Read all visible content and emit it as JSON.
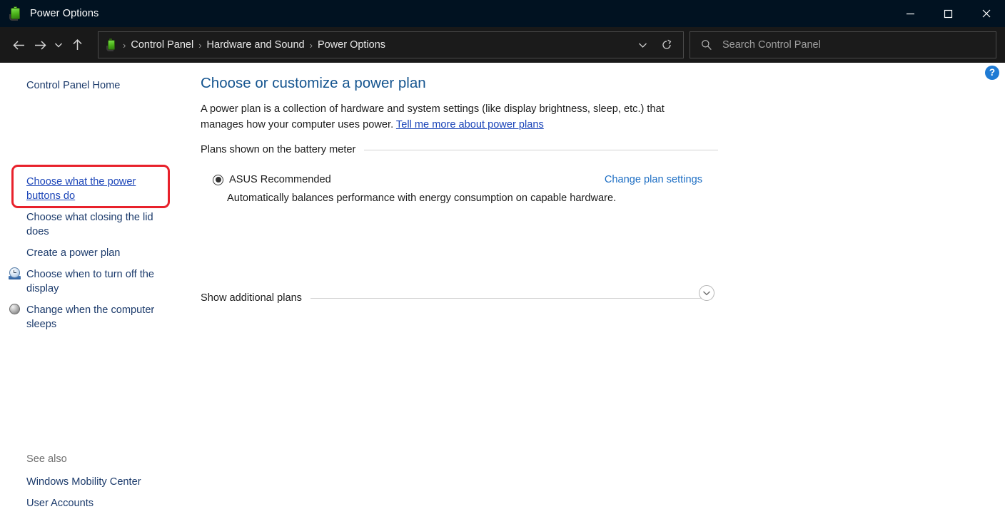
{
  "window": {
    "title": "Power Options",
    "icon": "battery-icon",
    "controls": {
      "minimize": "minimize-icon",
      "maximize": "maximize-icon",
      "close": "close-icon"
    }
  },
  "nav": {
    "back": "back-arrow-icon",
    "forward": "forward-arrow-icon",
    "recent": "chevron-down-icon",
    "up": "up-arrow-icon",
    "breadcrumb": [
      "Control Panel",
      "Hardware and Sound",
      "Power Options"
    ],
    "separator": "›",
    "history_dropdown": "chevron-down-icon",
    "refresh": "refresh-icon"
  },
  "search": {
    "placeholder": "Search Control Panel",
    "value": "",
    "icon": "search-icon"
  },
  "help": {
    "label": "?"
  },
  "sidebar": {
    "home": "Control Panel Home",
    "items": [
      {
        "label": "Choose what the power buttons do",
        "highlighted": true
      },
      {
        "label": "Choose what closing the lid does",
        "highlighted": false
      },
      {
        "label": "Create a power plan",
        "highlighted": false
      },
      {
        "label": "Choose when to turn off the display",
        "icon": "clock-display-icon"
      },
      {
        "label": "Change when the computer sleeps",
        "icon": "sleep-moon-icon"
      }
    ],
    "see_also_label": "See also",
    "see_also": [
      "Windows Mobility Center",
      "User Accounts"
    ]
  },
  "main": {
    "title": "Choose or customize a power plan",
    "description_part1": "A power plan is a collection of hardware and system settings (like display brightness, sleep, etc.) that manages how your computer uses power. ",
    "description_link": "Tell me more about power plans",
    "plans_section_label": "Plans shown on the battery meter",
    "plan": {
      "name": "ASUS Recommended",
      "selected": true,
      "description": "Automatically balances performance with energy consumption on capable hardware.",
      "change_link": "Change plan settings"
    },
    "additional_section_label": "Show additional plans",
    "expander_icon": "chevron-down-icon"
  },
  "colors": {
    "titlebar_bg": "#011221",
    "navbar_bg": "#191919",
    "accent_link": "#1a44b8",
    "heading": "#14548f",
    "highlight_box": "#e8212b",
    "help_blue": "#1f7bd4"
  }
}
